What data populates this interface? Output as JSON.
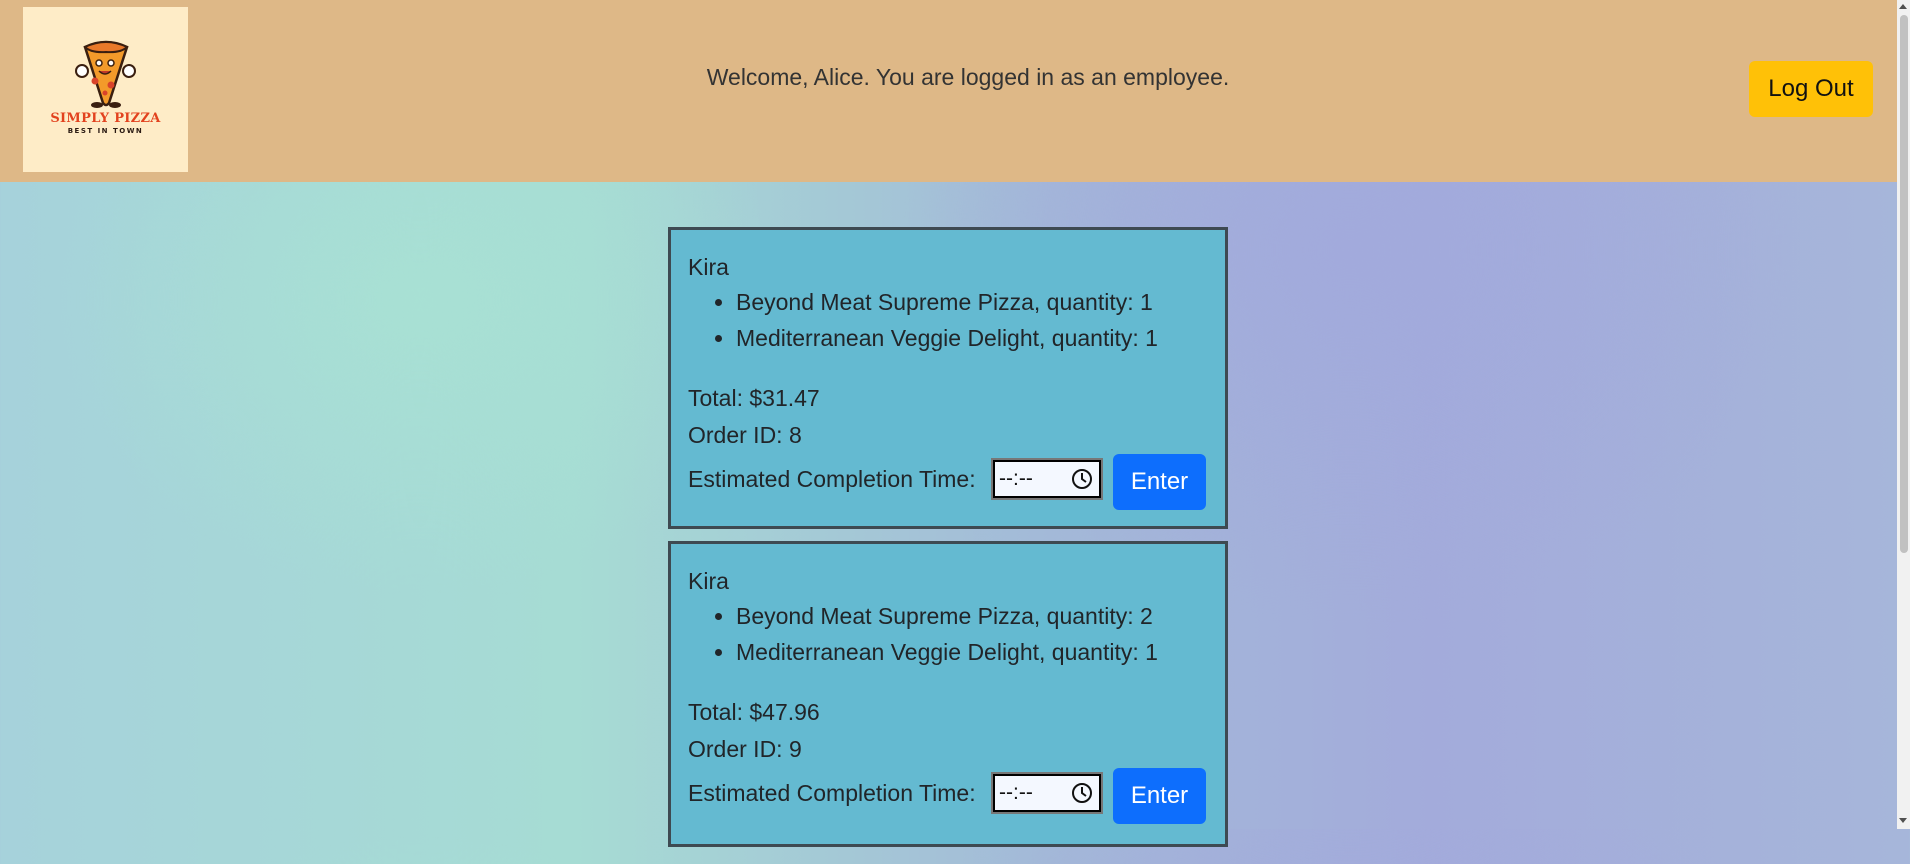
{
  "header": {
    "logo": {
      "title": "SIMPLY PIZZA",
      "subtitle": "BEST IN TOWN",
      "icon": "pizza-mascot-icon"
    },
    "welcome_text": "Welcome, Alice. You are logged in as an employee.",
    "logout_label": "Log Out"
  },
  "orders": [
    {
      "customer": "Kira",
      "items": [
        "Beyond Meat Supreme Pizza, quantity: 1",
        "Mediterranean Veggie Delight, quantity: 1"
      ],
      "total": "Total: $31.47",
      "order_id_label": "Order ID:",
      "order_id": "8",
      "eta_label": "Estimated Completion Time:",
      "time_value": "--:--",
      "enter_label": "Enter"
    },
    {
      "customer": "Kira",
      "items": [
        "Beyond Meat Supreme Pizza, quantity: 2",
        "Mediterranean Veggie Delight, quantity: 1"
      ],
      "total": "Total: $47.96",
      "order_id_label": "Order ID:",
      "order_id": "9",
      "eta_label": "Estimated Completion Time:",
      "time_value": "--:--",
      "enter_label": "Enter"
    }
  ],
  "colors": {
    "header_bg": "#deb887",
    "logout_button": "#ffc107",
    "order_card_bg": "#64bad1",
    "enter_button": "#0d6efd",
    "logo_text": "#e2421e"
  }
}
